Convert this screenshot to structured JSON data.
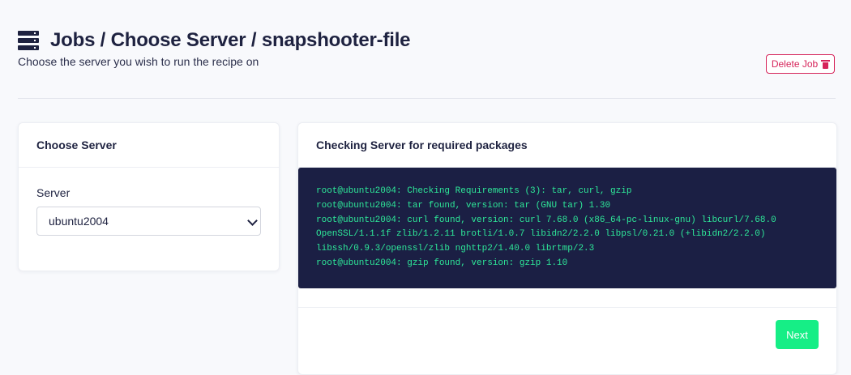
{
  "header": {
    "title": "Jobs / Choose Server / snapshooter-file",
    "subtitle": "Choose the server you wish to run the recipe on",
    "delete_label": "Delete Job"
  },
  "left_card": {
    "heading": "Choose Server",
    "field_label": "Server",
    "selected_server": "ubuntu2004"
  },
  "right_card": {
    "heading": "Checking Server for required packages",
    "terminal_lines": [
      "root@ubuntu2004: Checking Requirements (3): tar, curl, gzip",
      "root@ubuntu2004: tar found, version: tar (GNU tar) 1.30",
      "root@ubuntu2004: curl found, version: curl 7.68.0 (x86_64-pc-linux-gnu) libcurl/7.68.0",
      "OpenSSL/1.1.1f zlib/1.2.11 brotli/1.0.7 libidn2/2.2.0 libpsl/0.21.0 (+libidn2/2.2.0)",
      "libssh/0.9.3/openssl/zlib nghttp2/1.40.0 librtmp/2.3",
      "root@ubuntu2004: gzip found, version: gzip 1.10"
    ],
    "next_label": "Next"
  },
  "icons": {
    "title_icon": "server-icon",
    "delete_icon": "trash-icon",
    "select_icon": "chevron-down-icon"
  },
  "colors": {
    "danger": "#d6245a",
    "terminal_bg": "#1b1f44",
    "terminal_text": "#2ee899",
    "primary": "#16ee86"
  }
}
